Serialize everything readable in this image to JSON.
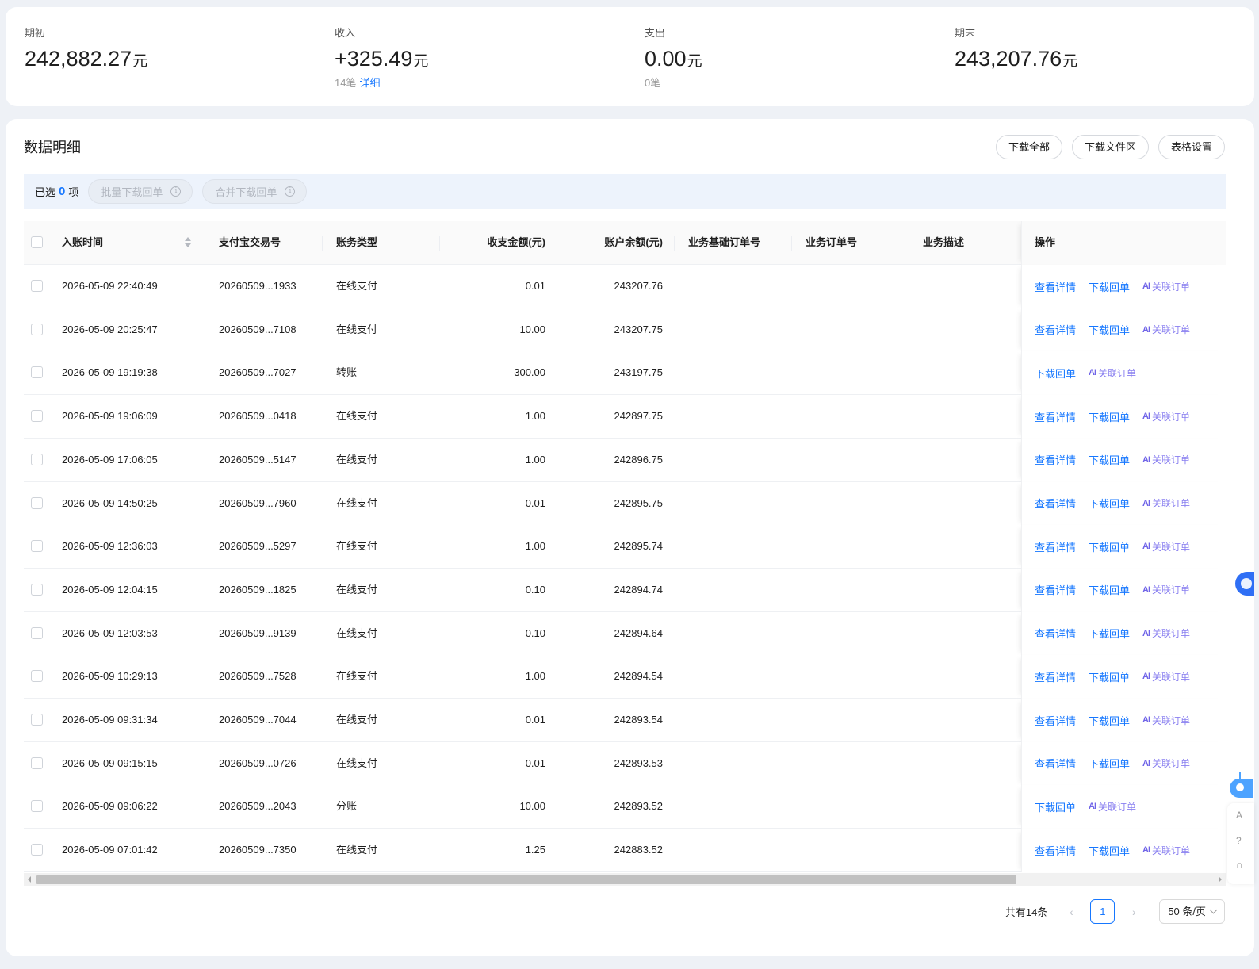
{
  "summary": [
    {
      "label": "期初",
      "value": "242,882.27",
      "unit": "元",
      "count": "",
      "link": ""
    },
    {
      "label": "收入",
      "value": "+325.49",
      "unit": "元",
      "count": "14笔",
      "link": "详细"
    },
    {
      "label": "支出",
      "value": "0.00",
      "unit": "元",
      "count": "0笔",
      "link": ""
    },
    {
      "label": "期末",
      "value": "243,207.76",
      "unit": "元",
      "count": "",
      "link": ""
    }
  ],
  "detail": {
    "title": "数据明细",
    "buttons": {
      "download_all": "下载全部",
      "download_files": "下载文件区",
      "table_settings": "表格设置"
    }
  },
  "selection": {
    "prefix": "已选",
    "count": "0",
    "suffix": "项",
    "batch_download": "批量下载回单",
    "merge_download": "合并下载回单",
    "info_glyph": "i"
  },
  "table": {
    "headers": {
      "time": "入账时间",
      "tx_no": "支付宝交易号",
      "type": "账务类型",
      "amount": "收支金额(元)",
      "balance": "账户余额(元)",
      "base_order": "业务基础订单号",
      "biz_order": "业务订单号",
      "desc": "业务描述",
      "ops": "操作"
    },
    "op_labels": {
      "view": "查看详情",
      "download": "下载回单",
      "related": "关联订单",
      "related_glyph": "AI"
    },
    "rows": [
      {
        "time": "2026-05-09 22:40:49",
        "tx": "20260509...1933",
        "type": "在线支付",
        "amount": "0.01",
        "balance": "243207.76",
        "view": true
      },
      {
        "time": "2026-05-09 20:25:47",
        "tx": "20260509...7108",
        "type": "在线支付",
        "amount": "10.00",
        "balance": "243207.75",
        "view": true
      },
      {
        "time": "2026-05-09 19:19:38",
        "tx": "20260509...7027",
        "type": "转账",
        "amount": "300.00",
        "balance": "243197.75",
        "view": false
      },
      {
        "time": "2026-05-09 19:06:09",
        "tx": "20260509...0418",
        "type": "在线支付",
        "amount": "1.00",
        "balance": "242897.75",
        "view": true
      },
      {
        "time": "2026-05-09 17:06:05",
        "tx": "20260509...5147",
        "type": "在线支付",
        "amount": "1.00",
        "balance": "242896.75",
        "view": true
      },
      {
        "time": "2026-05-09 14:50:25",
        "tx": "20260509...7960",
        "type": "在线支付",
        "amount": "0.01",
        "balance": "242895.75",
        "view": true
      },
      {
        "time": "2026-05-09 12:36:03",
        "tx": "20260509...5297",
        "type": "在线支付",
        "amount": "1.00",
        "balance": "242895.74",
        "view": true
      },
      {
        "time": "2026-05-09 12:04:15",
        "tx": "20260509...1825",
        "type": "在线支付",
        "amount": "0.10",
        "balance": "242894.74",
        "view": true
      },
      {
        "time": "2026-05-09 12:03:53",
        "tx": "20260509...9139",
        "type": "在线支付",
        "amount": "0.10",
        "balance": "242894.64",
        "view": true
      },
      {
        "time": "2026-05-09 10:29:13",
        "tx": "20260509...7528",
        "type": "在线支付",
        "amount": "1.00",
        "balance": "242894.54",
        "view": true
      },
      {
        "time": "2026-05-09 09:31:34",
        "tx": "20260509...7044",
        "type": "在线支付",
        "amount": "0.01",
        "balance": "242893.54",
        "view": true
      },
      {
        "time": "2026-05-09 09:15:15",
        "tx": "20260509...0726",
        "type": "在线支付",
        "amount": "0.01",
        "balance": "242893.53",
        "view": true
      },
      {
        "time": "2026-05-09 09:06:22",
        "tx": "20260509...2043",
        "type": "分账",
        "amount": "10.00",
        "balance": "242893.52",
        "view": false
      },
      {
        "time": "2026-05-09 07:01:42",
        "tx": "20260509...7350",
        "type": "在线支付",
        "amount": "1.25",
        "balance": "242883.52",
        "view": true
      }
    ]
  },
  "pagination": {
    "total": "共有14条",
    "current": "1",
    "page_size": "50 条/页",
    "prev": "‹",
    "next": "›"
  },
  "side_tools": {
    "letter": "A"
  },
  "colors": {
    "primary": "#1677ff",
    "ai_purple": "#8a80f0",
    "selection_bg": "#edf3fc"
  }
}
